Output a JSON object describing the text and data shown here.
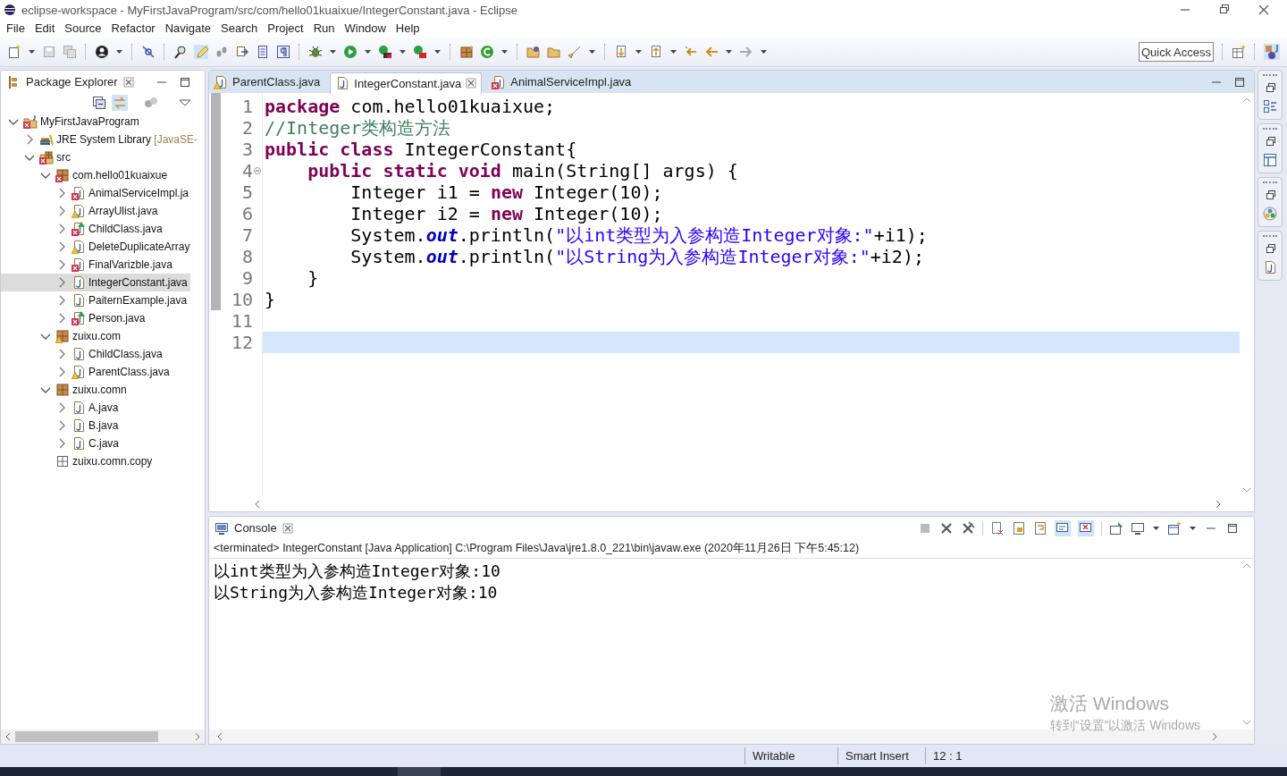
{
  "window": {
    "title": "eclipse-workspace - MyFirstJavaProgram/src/com/hello01kuaixue/IntegerConstant.java - Eclipse"
  },
  "menu": [
    "File",
    "Edit",
    "Source",
    "Refactor",
    "Navigate",
    "Search",
    "Project",
    "Run",
    "Window",
    "Help"
  ],
  "toolbar": {
    "highlight_on": true
  },
  "quick_access": {
    "placeholder": "Quick Access"
  },
  "package_explorer": {
    "title": "Package Explorer",
    "link_on": true,
    "tree": [
      {
        "label": "MyFirstJavaProgram",
        "kind": "project",
        "has_error": true,
        "has_warning": false,
        "expanded": true,
        "selected": false,
        "runnable": false,
        "children": [
          {
            "label": "JRE System Library",
            "suffix": "[JavaSE-",
            "kind": "library",
            "has_error": false,
            "has_warning": false,
            "expanded": false,
            "selected": false,
            "runnable": false
          },
          {
            "label": "src",
            "kind": "folder",
            "has_error": true,
            "has_warning": false,
            "expanded": true,
            "selected": false,
            "runnable": false,
            "children": [
              {
                "label": "com.hello01kuaixue",
                "kind": "package",
                "has_error": true,
                "has_warning": false,
                "expanded": true,
                "selected": false,
                "runnable": false,
                "children": [
                  {
                    "label": "AnimalServiceImpl.ja",
                    "kind": "file",
                    "has_error": true,
                    "has_warning": false,
                    "expanded": false,
                    "selected": false,
                    "runnable": false
                  },
                  {
                    "label": "ArrayUlist.java",
                    "kind": "file",
                    "has_error": false,
                    "has_warning": true,
                    "expanded": false,
                    "selected": false,
                    "runnable": false
                  },
                  {
                    "label": "ChildClass.java",
                    "kind": "file",
                    "has_error": true,
                    "has_warning": false,
                    "expanded": false,
                    "selected": false,
                    "runnable": true
                  },
                  {
                    "label": "DeleteDuplicateArray",
                    "kind": "file",
                    "has_error": false,
                    "has_warning": true,
                    "expanded": false,
                    "selected": false,
                    "runnable": false
                  },
                  {
                    "label": "FinalVarizble.java",
                    "kind": "file",
                    "has_error": true,
                    "has_warning": false,
                    "expanded": false,
                    "selected": false,
                    "runnable": false
                  },
                  {
                    "label": "IntegerConstant.java",
                    "kind": "file",
                    "has_error": false,
                    "has_warning": false,
                    "expanded": false,
                    "selected": true,
                    "runnable": false
                  },
                  {
                    "label": "PaiternExample.java",
                    "kind": "file",
                    "has_error": false,
                    "has_warning": false,
                    "expanded": false,
                    "selected": false,
                    "runnable": false
                  },
                  {
                    "label": "Person.java",
                    "kind": "file",
                    "has_error": true,
                    "has_warning": false,
                    "expanded": false,
                    "selected": false,
                    "runnable": true
                  }
                ]
              },
              {
                "label": "zuixu.com",
                "kind": "package",
                "has_error": false,
                "has_warning": true,
                "expanded": true,
                "selected": false,
                "runnable": false,
                "children": [
                  {
                    "label": "ChildClass.java",
                    "kind": "file",
                    "has_error": false,
                    "has_warning": false,
                    "expanded": false,
                    "selected": false,
                    "runnable": false
                  },
                  {
                    "label": "ParentClass.java",
                    "kind": "file",
                    "has_error": false,
                    "has_warning": true,
                    "expanded": false,
                    "selected": false,
                    "runnable": false
                  }
                ]
              },
              {
                "label": "zuixu.comn",
                "kind": "package",
                "has_error": false,
                "has_warning": false,
                "expanded": true,
                "selected": false,
                "runnable": false,
                "children": [
                  {
                    "label": "A.java",
                    "kind": "file",
                    "has_error": false,
                    "has_warning": false,
                    "expanded": false,
                    "selected": false,
                    "runnable": false
                  },
                  {
                    "label": "B.java",
                    "kind": "file",
                    "has_error": false,
                    "has_warning": false,
                    "expanded": false,
                    "selected": false,
                    "runnable": false
                  },
                  {
                    "label": "C.java",
                    "kind": "file",
                    "has_error": false,
                    "has_warning": false,
                    "expanded": false,
                    "selected": false,
                    "runnable": false
                  }
                ]
              },
              {
                "label": "zuixu.comn.copy",
                "kind": "empty-package",
                "has_error": false,
                "has_warning": false,
                "selected": false,
                "runnable": false
              }
            ]
          }
        ]
      }
    ]
  },
  "editor": {
    "tabs": [
      {
        "label": "ParentClass.java",
        "selected": false,
        "has_error": false,
        "has_warning": true
      },
      {
        "label": "IntegerConstant.java",
        "selected": true,
        "has_error": false,
        "has_warning": false
      },
      {
        "label": "AnimalServiceImpl.java",
        "selected": false,
        "has_error": true,
        "has_warning": false
      }
    ],
    "lines": [
      {
        "number": "1",
        "current": false,
        "foldable": false,
        "tokens": [
          {
            "kind": "keyword",
            "text": "package"
          },
          {
            "kind": "plain",
            "text": " com.hello01kuaixue;"
          }
        ]
      },
      {
        "number": "2",
        "current": false,
        "foldable": false,
        "tokens": [
          {
            "kind": "comment",
            "text": "//Integer类构造方法"
          }
        ]
      },
      {
        "number": "3",
        "current": false,
        "foldable": false,
        "tokens": [
          {
            "kind": "keyword",
            "text": "public class"
          },
          {
            "kind": "plain",
            "text": " IntegerConstant{"
          }
        ]
      },
      {
        "number": "4",
        "current": false,
        "foldable": true,
        "tokens": [
          {
            "kind": "keyword",
            "text": "    public static void"
          },
          {
            "kind": "plain",
            "text": " main(String[] args) {"
          }
        ]
      },
      {
        "number": "5",
        "current": false,
        "foldable": false,
        "tokens": [
          {
            "kind": "plain",
            "text": "        Integer i1 = "
          },
          {
            "kind": "keyword",
            "text": "new"
          },
          {
            "kind": "plain",
            "text": " Integer(10);"
          }
        ]
      },
      {
        "number": "6",
        "current": false,
        "foldable": false,
        "tokens": [
          {
            "kind": "plain",
            "text": "        Integer i2 = "
          },
          {
            "kind": "keyword",
            "text": "new"
          },
          {
            "kind": "plain",
            "text": " Integer(10);"
          }
        ]
      },
      {
        "number": "7",
        "current": false,
        "foldable": false,
        "tokens": [
          {
            "kind": "plain",
            "text": "        System."
          },
          {
            "kind": "field",
            "text": "out"
          },
          {
            "kind": "plain",
            "text": ".println("
          },
          {
            "kind": "string",
            "text": "\"以int类型为入参构造Integer对象:\""
          },
          {
            "kind": "plain",
            "text": "+i1);"
          }
        ]
      },
      {
        "number": "8",
        "current": false,
        "foldable": false,
        "tokens": [
          {
            "kind": "plain",
            "text": "        System."
          },
          {
            "kind": "field",
            "text": "out"
          },
          {
            "kind": "plain",
            "text": ".println("
          },
          {
            "kind": "string",
            "text": "\"以String为入参构造Integer对象:\""
          },
          {
            "kind": "plain",
            "text": "+i2);"
          }
        ]
      },
      {
        "number": "9",
        "current": false,
        "foldable": false,
        "tokens": [
          {
            "kind": "plain",
            "text": "    }"
          }
        ]
      },
      {
        "number": "10",
        "current": false,
        "foldable": false,
        "tokens": [
          {
            "kind": "plain",
            "text": "}"
          }
        ]
      },
      {
        "number": "11",
        "current": false,
        "foldable": false
      },
      {
        "number": "12",
        "current": true,
        "foldable": false
      }
    ]
  },
  "console": {
    "title": "Console",
    "show_on_output": true,
    "show_on_error": true,
    "status": "<terminated> IntegerConstant [Java Application] C:\\Program Files\\Java\\jre1.8.0_221\\bin\\javaw.exe (2020年11月26日 下午5:45:12)",
    "output": [
      "以int类型为入参构造Integer对象:10",
      "以String为入参构造Integer对象:10"
    ]
  },
  "status_bar": [
    "Writable",
    "Smart Insert",
    "12 : 1"
  ],
  "activation_notice": {
    "title": "激活 Windows",
    "hint": "转到“设置”以激活 Windows"
  }
}
